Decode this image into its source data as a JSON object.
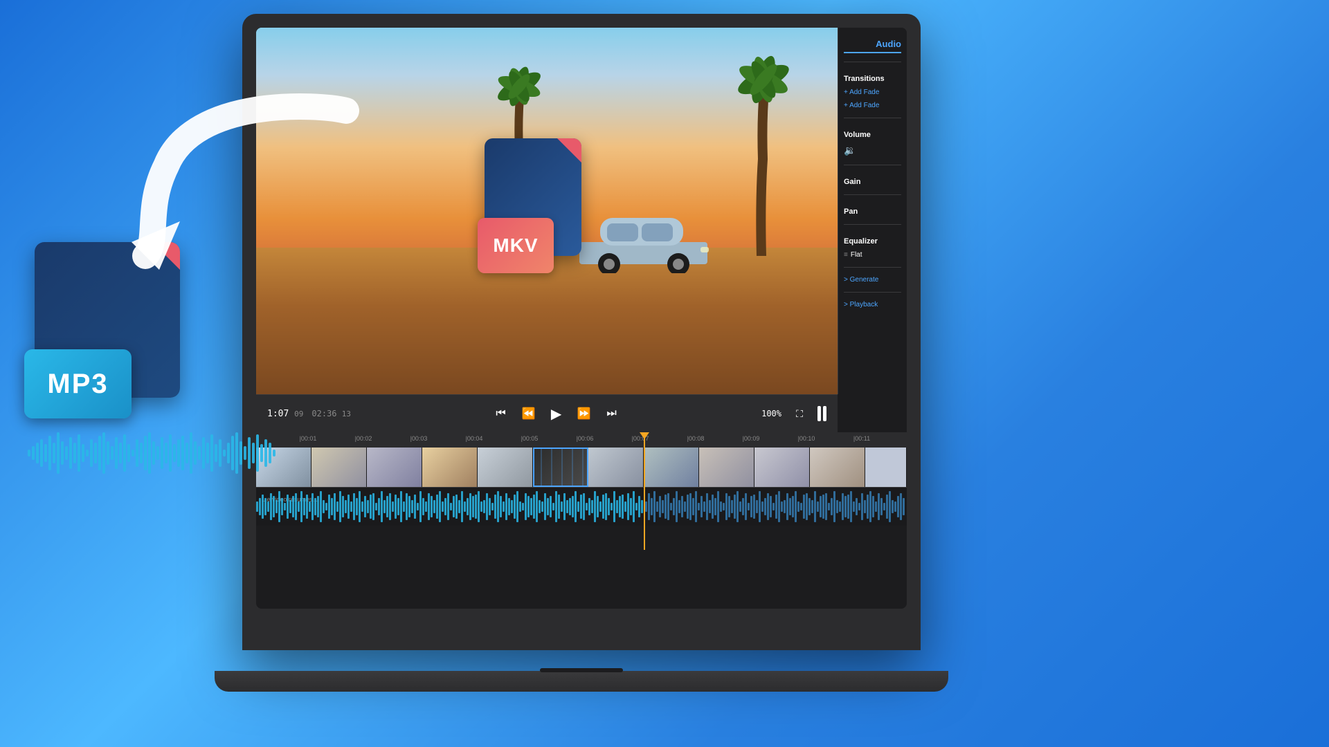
{
  "background": {
    "gradient_start": "#1a6fd8",
    "gradient_end": "#4db8ff"
  },
  "laptop": {
    "screen_bg": "#1c1c1e"
  },
  "video_player": {
    "current_time": "1:07",
    "current_frame": "09",
    "total_time": "02:36",
    "total_frame": "13",
    "zoom": "100%"
  },
  "right_panel": {
    "tab_audio": "Audio",
    "transitions_label": "Transitions",
    "add_fade_in": "+ Add Fade",
    "add_fade_out": "+ Add Fade",
    "volume_label": "Volume",
    "gain_label": "Gain",
    "pan_label": "Pan",
    "equalizer_label": "Equalizer",
    "equalizer_value": "Flat",
    "generate_label": "> Generate",
    "playback_label": "> Playback"
  },
  "timeline": {
    "ruler_ticks": [
      "00:01",
      "00:02",
      "00:03",
      "00:04",
      "00:05",
      "00:06",
      "00:07",
      "00:08",
      "00:09",
      "00:10",
      "00:11"
    ]
  },
  "mkv_icon": {
    "label": "MKV"
  },
  "mp3_icon": {
    "label": "MP3"
  },
  "controls": {
    "skip_back": "⏮",
    "rewind": "⏪",
    "play": "▶",
    "fast_forward": "⏩",
    "skip_forward": "⏭"
  }
}
